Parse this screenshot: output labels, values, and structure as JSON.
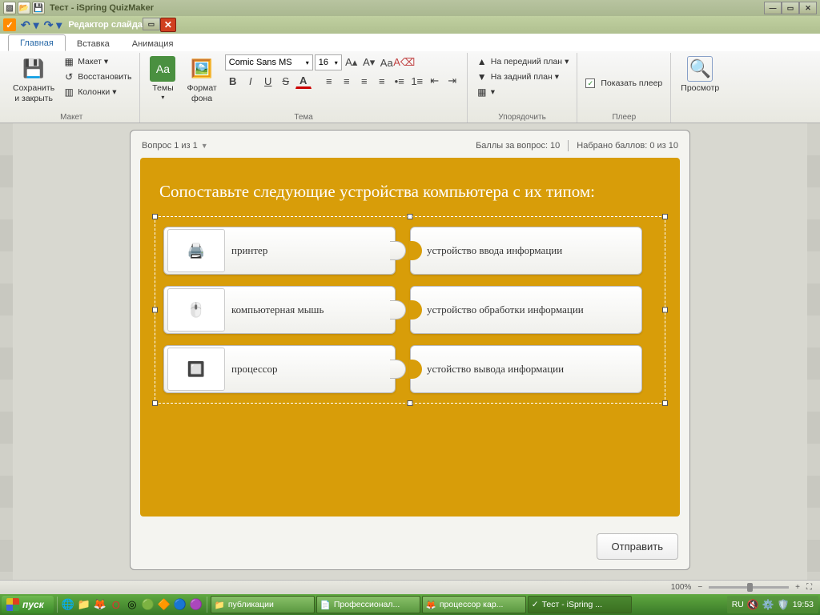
{
  "outer_window": {
    "title": "Тест - iSpring QuizMaker"
  },
  "editor_bar": {
    "title": "Редактор слайда"
  },
  "ribbon": {
    "tabs": [
      {
        "label": "Главная",
        "active": true
      },
      {
        "label": "Вставка"
      },
      {
        "label": "Анимация"
      }
    ],
    "groups": {
      "layout": {
        "label": "Макет",
        "save_close": "Сохранить\nи закрыть",
        "maket": "Макет",
        "restore": "Восстановить",
        "columns": "Колонки"
      },
      "theme": {
        "label": "Тема",
        "themes": "Темы",
        "background": "Формат\nфона",
        "font_name": "Comic Sans MS",
        "font_size": "16"
      },
      "arrange": {
        "label": "Упорядочить",
        "to_front": "На передний план",
        "to_back": "На задний план"
      },
      "player": {
        "label": "Плеер",
        "show_player": "Показать плеер"
      },
      "preview": {
        "label": "Просмотр"
      }
    }
  },
  "slide": {
    "question_counter": "Вопрос 1 из 1",
    "points_label": "Баллы за вопрос: 10",
    "score_label": "Набрано баллов: 0 из 10",
    "title": "Сопоставьте следующие устройства  компьютера с их типом:",
    "left_items": [
      {
        "label": "принтер"
      },
      {
        "label": "компьютерная мышь"
      },
      {
        "label": "процессор"
      }
    ],
    "right_items": [
      {
        "label": "устройство ввода информации"
      },
      {
        "label": "устройство обработки информации"
      },
      {
        "label": "устойство вывода информации"
      }
    ],
    "submit": "Отправить"
  },
  "status": {
    "zoom": "100%"
  },
  "taskbar": {
    "start": "пуск",
    "tasks": [
      {
        "label": "публикации"
      },
      {
        "label": "Профессионал..."
      },
      {
        "label": "процессор кар..."
      },
      {
        "label": "Тест - iSpring ...",
        "active": true
      }
    ],
    "lang": "RU",
    "clock": "19:53"
  }
}
